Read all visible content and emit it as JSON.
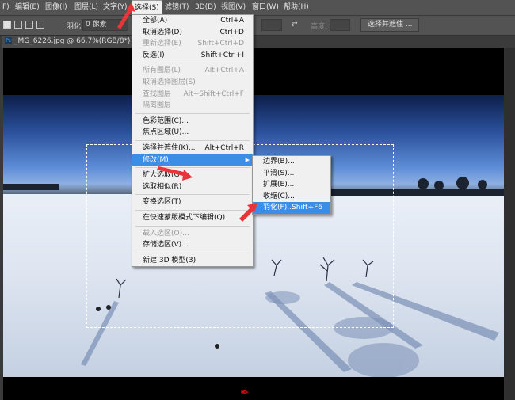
{
  "menubar": {
    "items": [
      "F)",
      "编辑(E)",
      "图像(I)",
      "图层(L)",
      "文字(Y)",
      "选择(S)",
      "滤镜(T)",
      "3D(D)",
      "视图(V)",
      "窗口(W)",
      "帮助(H)"
    ]
  },
  "options": {
    "feather_label": "羽化:",
    "feather_value": "0 像素",
    "height_label": "高度:",
    "select_and_mask": "选择并遮住 ..."
  },
  "document": {
    "tab_title": "_MG_6226.jpg @ 66.7%(RGB/8*)",
    "ps_badge": "Ps",
    "close": "×"
  },
  "select_menu": {
    "items": [
      {
        "label": "全部(A)",
        "shortcut": "Ctrl+A",
        "disabled": false
      },
      {
        "label": "取消选择(D)",
        "shortcut": "Ctrl+D",
        "disabled": false
      },
      {
        "label": "重新选择(E)",
        "shortcut": "Shift+Ctrl+D",
        "disabled": true
      },
      {
        "label": "反选(I)",
        "shortcut": "Shift+Ctrl+I",
        "disabled": false
      },
      {
        "sep": true
      },
      {
        "label": "所有图层(L)",
        "shortcut": "Alt+Ctrl+A",
        "disabled": true
      },
      {
        "label": "取消选择图层(S)",
        "shortcut": "",
        "disabled": true
      },
      {
        "label": "查找图层",
        "shortcut": "Alt+Shift+Ctrl+F",
        "disabled": true
      },
      {
        "label": "隔离图层",
        "shortcut": "",
        "disabled": true
      },
      {
        "sep": true
      },
      {
        "label": "色彩范围(C)...",
        "shortcut": "",
        "disabled": false
      },
      {
        "label": "焦点区域(U)...",
        "shortcut": "",
        "disabled": false
      },
      {
        "sep": true
      },
      {
        "label": "选择并遮住(K)...",
        "shortcut": "Alt+Ctrl+R",
        "disabled": false
      },
      {
        "label": "修改(M)",
        "shortcut": "",
        "disabled": false,
        "highlighted": true,
        "submenu": true
      },
      {
        "sep": true
      },
      {
        "label": "扩大选取(G)",
        "shortcut": "",
        "disabled": false
      },
      {
        "label": "选取相似(R)",
        "shortcut": "",
        "disabled": false
      },
      {
        "sep": true
      },
      {
        "label": "变换选区(T)",
        "shortcut": "",
        "disabled": false
      },
      {
        "sep": true
      },
      {
        "label": "在快速蒙版模式下编辑(Q)",
        "shortcut": "",
        "disabled": false
      },
      {
        "sep": true
      },
      {
        "label": "载入选区(O)...",
        "shortcut": "",
        "disabled": true
      },
      {
        "label": "存储选区(V)...",
        "shortcut": "",
        "disabled": false
      },
      {
        "sep": true
      },
      {
        "label": "新建 3D 模型(3)",
        "shortcut": "",
        "disabled": false
      }
    ]
  },
  "modify_submenu": {
    "items": [
      {
        "label": "边界(B)...",
        "shortcut": ""
      },
      {
        "label": "平滑(S)...",
        "shortcut": ""
      },
      {
        "label": "扩展(E)...",
        "shortcut": ""
      },
      {
        "label": "收缩(C)...",
        "shortcut": ""
      },
      {
        "label": "羽化(F)...",
        "shortcut": "Shift+F6",
        "highlighted": true
      }
    ]
  },
  "colors": {
    "highlight": "#3c8de6",
    "pointer": "#e8353a"
  }
}
